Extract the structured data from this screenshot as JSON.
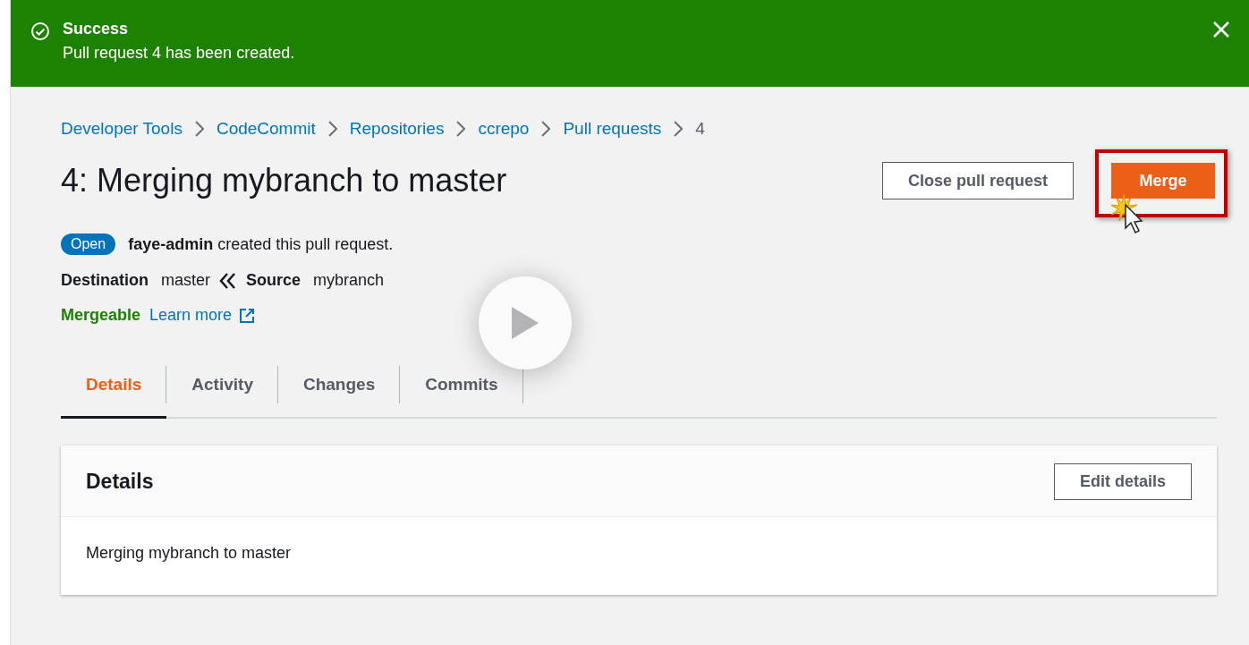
{
  "flash": {
    "title": "Success",
    "message": "Pull request 4 has been created."
  },
  "breadcrumbs": [
    {
      "label": "Developer Tools",
      "link": true
    },
    {
      "label": "CodeCommit",
      "link": true
    },
    {
      "label": "Repositories",
      "link": true
    },
    {
      "label": "ccrepo",
      "link": true
    },
    {
      "label": "Pull requests",
      "link": true
    },
    {
      "label": "4",
      "link": false
    }
  ],
  "title": "4: Merging mybranch to master",
  "actions": [
    {
      "label": "Close pull request",
      "kind": "normal"
    },
    {
      "label": "Merge",
      "kind": "primary"
    }
  ],
  "status": {
    "badge": "Open",
    "author": "faye-admin",
    "text": "created this pull request."
  },
  "branches": {
    "destination_label": "Destination",
    "destination": "master",
    "source_label": "Source",
    "source": "mybranch"
  },
  "merge": {
    "status": "Mergeable",
    "link": "Learn more"
  },
  "tabs": [
    {
      "label": "Details",
      "selected": true
    },
    {
      "label": "Activity",
      "selected": false
    },
    {
      "label": "Changes",
      "selected": false
    },
    {
      "label": "Commits",
      "selected": false
    }
  ],
  "details": {
    "heading": "Details",
    "button": "Edit details",
    "description": "Merging mybranch to master"
  }
}
